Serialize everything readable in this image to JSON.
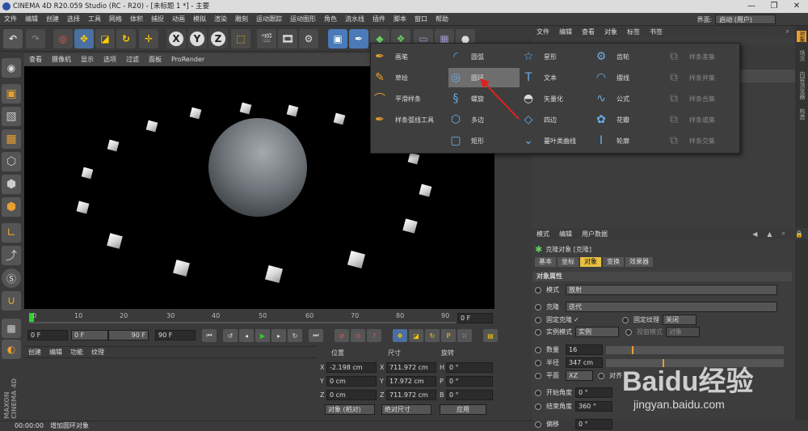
{
  "title": "CINEMA 4D R20.059 Studio (RC - R20) - [未标题 1 *] - 主要",
  "window_controls": [
    "—",
    "❐",
    "✕"
  ],
  "menu": [
    "文件",
    "编辑",
    "创建",
    "选择",
    "工具",
    "网格",
    "体积",
    "捕捉",
    "动画",
    "模拟",
    "渲染",
    "雕刻",
    "运动跟踪",
    "运动图形",
    "角色",
    "流水线",
    "插件",
    "脚本",
    "窗口",
    "帮助"
  ],
  "interface_label": "界面:",
  "interface_value": "启动 (用户)",
  "toolbar_icons": [
    "undo-icon",
    "redo-icon",
    "live-select-icon",
    "move-icon",
    "scale-icon",
    "rotate-icon",
    "add-icon",
    "x-axis-icon",
    "y-axis-icon",
    "z-axis-icon",
    "coordinate-system-icon",
    "render-view-icon",
    "render-picture-viewer-icon",
    "render-settings-icon",
    "cube-icon",
    "pen-icon",
    "generator-icon",
    "deformer-icon",
    "floor-icon",
    "scene-icon",
    "light-icon"
  ],
  "axis_labels": [
    "X",
    "Y",
    "Z"
  ],
  "viewport_menu": [
    "查看",
    "摄像机",
    "显示",
    "选项",
    "过滤",
    "面板",
    "ProRender"
  ],
  "timeline_ticks": [
    "0",
    "10",
    "20",
    "30",
    "40",
    "50",
    "60",
    "70",
    "80",
    "90"
  ],
  "timeline_frame": "0 F",
  "playback": {
    "start": "0 F",
    "range_start": "0 F",
    "range_end": "90 F",
    "end": "90 F"
  },
  "material_menu": [
    "创建",
    "编辑",
    "功能",
    "纹理"
  ],
  "coords": {
    "headers": [
      "位置",
      "尺寸",
      "旋转"
    ],
    "rows": [
      {
        "a": "X",
        "p": "-2.198 cm",
        "b": "X",
        "s": "711.972 cm",
        "c": "H",
        "r": "0 °"
      },
      {
        "a": "Y",
        "p": "0 cm",
        "b": "Y",
        "s": "17.972 cm",
        "c": "P",
        "r": "0 °"
      },
      {
        "a": "Z",
        "p": "0 cm",
        "b": "Z",
        "s": "711.972 cm",
        "c": "B",
        "r": "0 °"
      }
    ],
    "object_mode": "对象 (相对)",
    "size_mode": "绝对尺寸",
    "apply": "应用"
  },
  "status": {
    "time": "00:00:00",
    "message": "增加圆环对象"
  },
  "brand": "MAXON CINEMA 4D",
  "object_manager_menu": [
    "文件",
    "编辑",
    "查看",
    "对象",
    "标签",
    "书签"
  ],
  "right_vtabs": [
    "对象",
    "场次",
    "内容浏览器",
    "构造",
    "层"
  ],
  "attr_menu": [
    "模式",
    "编辑",
    "用户数据"
  ],
  "attr_object": "克隆对象 [克隆]",
  "attr_tabs": [
    "基本",
    "坐标",
    "对象",
    "变换",
    "效果器"
  ],
  "attr_section": "对象属性",
  "attrs": {
    "mode_label": "模式",
    "mode_value": "放射",
    "clones_label": "克隆",
    "clones_value": "迭代",
    "fixed_clone": "固定克隆",
    "fixed_clone_check": "✓",
    "fixed_texture": "固定纹理",
    "fixed_texture_value": "关闭",
    "instance_mode": "实例模式",
    "instance_value": "实例",
    "viewport_mode": "视窗模式",
    "viewport_value": "对象",
    "count_label": "数量",
    "count_value": "16",
    "radius_label": "半径",
    "radius_value": "347 cm",
    "plane_label": "平面",
    "plane_value": "XZ",
    "align_label": "对齐",
    "start_angle_label": "开始角度",
    "start_angle_value": "0 °",
    "end_angle_label": "结束角度",
    "end_angle_value": "360 °",
    "offset_label": "偏移",
    "offset_value": "0 °"
  },
  "popup": {
    "col1": [
      "画笔",
      "草绘",
      "平滑样条",
      "样条弧线工具"
    ],
    "col2": [
      "圆弧",
      "圆环",
      "螺旋",
      "多边",
      "矩形"
    ],
    "col3": [
      "星形",
      "文本",
      "矢量化",
      "四边",
      "蔓叶类曲线"
    ],
    "col4": [
      "齿轮",
      "摆线",
      "公式",
      "花瓣",
      "轮廓"
    ],
    "col5": [
      "样条差集",
      "样条并集",
      "样条合集",
      "样条或集",
      "样条交集"
    ]
  },
  "watermark": "Baidu经验",
  "watermark_url": "jingyan.baidu.com"
}
